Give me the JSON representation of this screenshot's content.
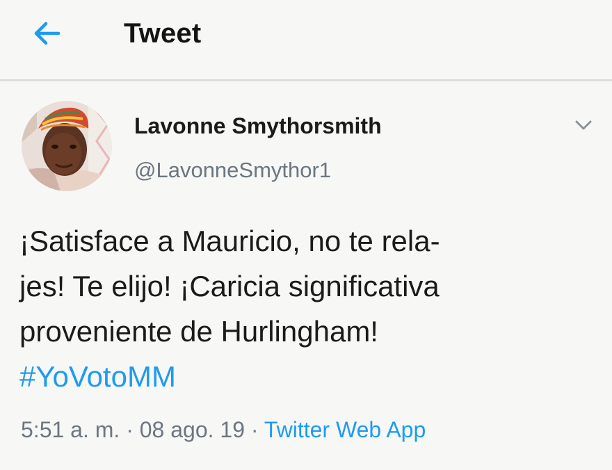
{
  "header": {
    "title": "Tweet",
    "back_icon": "arrow-left-icon",
    "accent_color": "#1d9bf0"
  },
  "author": {
    "display_name": "Lavonne Smythorsmith",
    "handle": "@LavonneSmythor1",
    "menu_icon": "chevron-down-icon"
  },
  "tweet": {
    "lines": [
      "¡Satisface a Mauricio, no te rela-",
      "jes! Te elijo! ¡Caricia significativa",
      "proveniente de Hurlingham!"
    ],
    "hashtag": "#YoVotoMM"
  },
  "meta": {
    "time": "5:51 a. m.",
    "sep1": " · ",
    "date": "08 ago. 19",
    "sep2": " · ",
    "source": "Twitter Web App"
  }
}
